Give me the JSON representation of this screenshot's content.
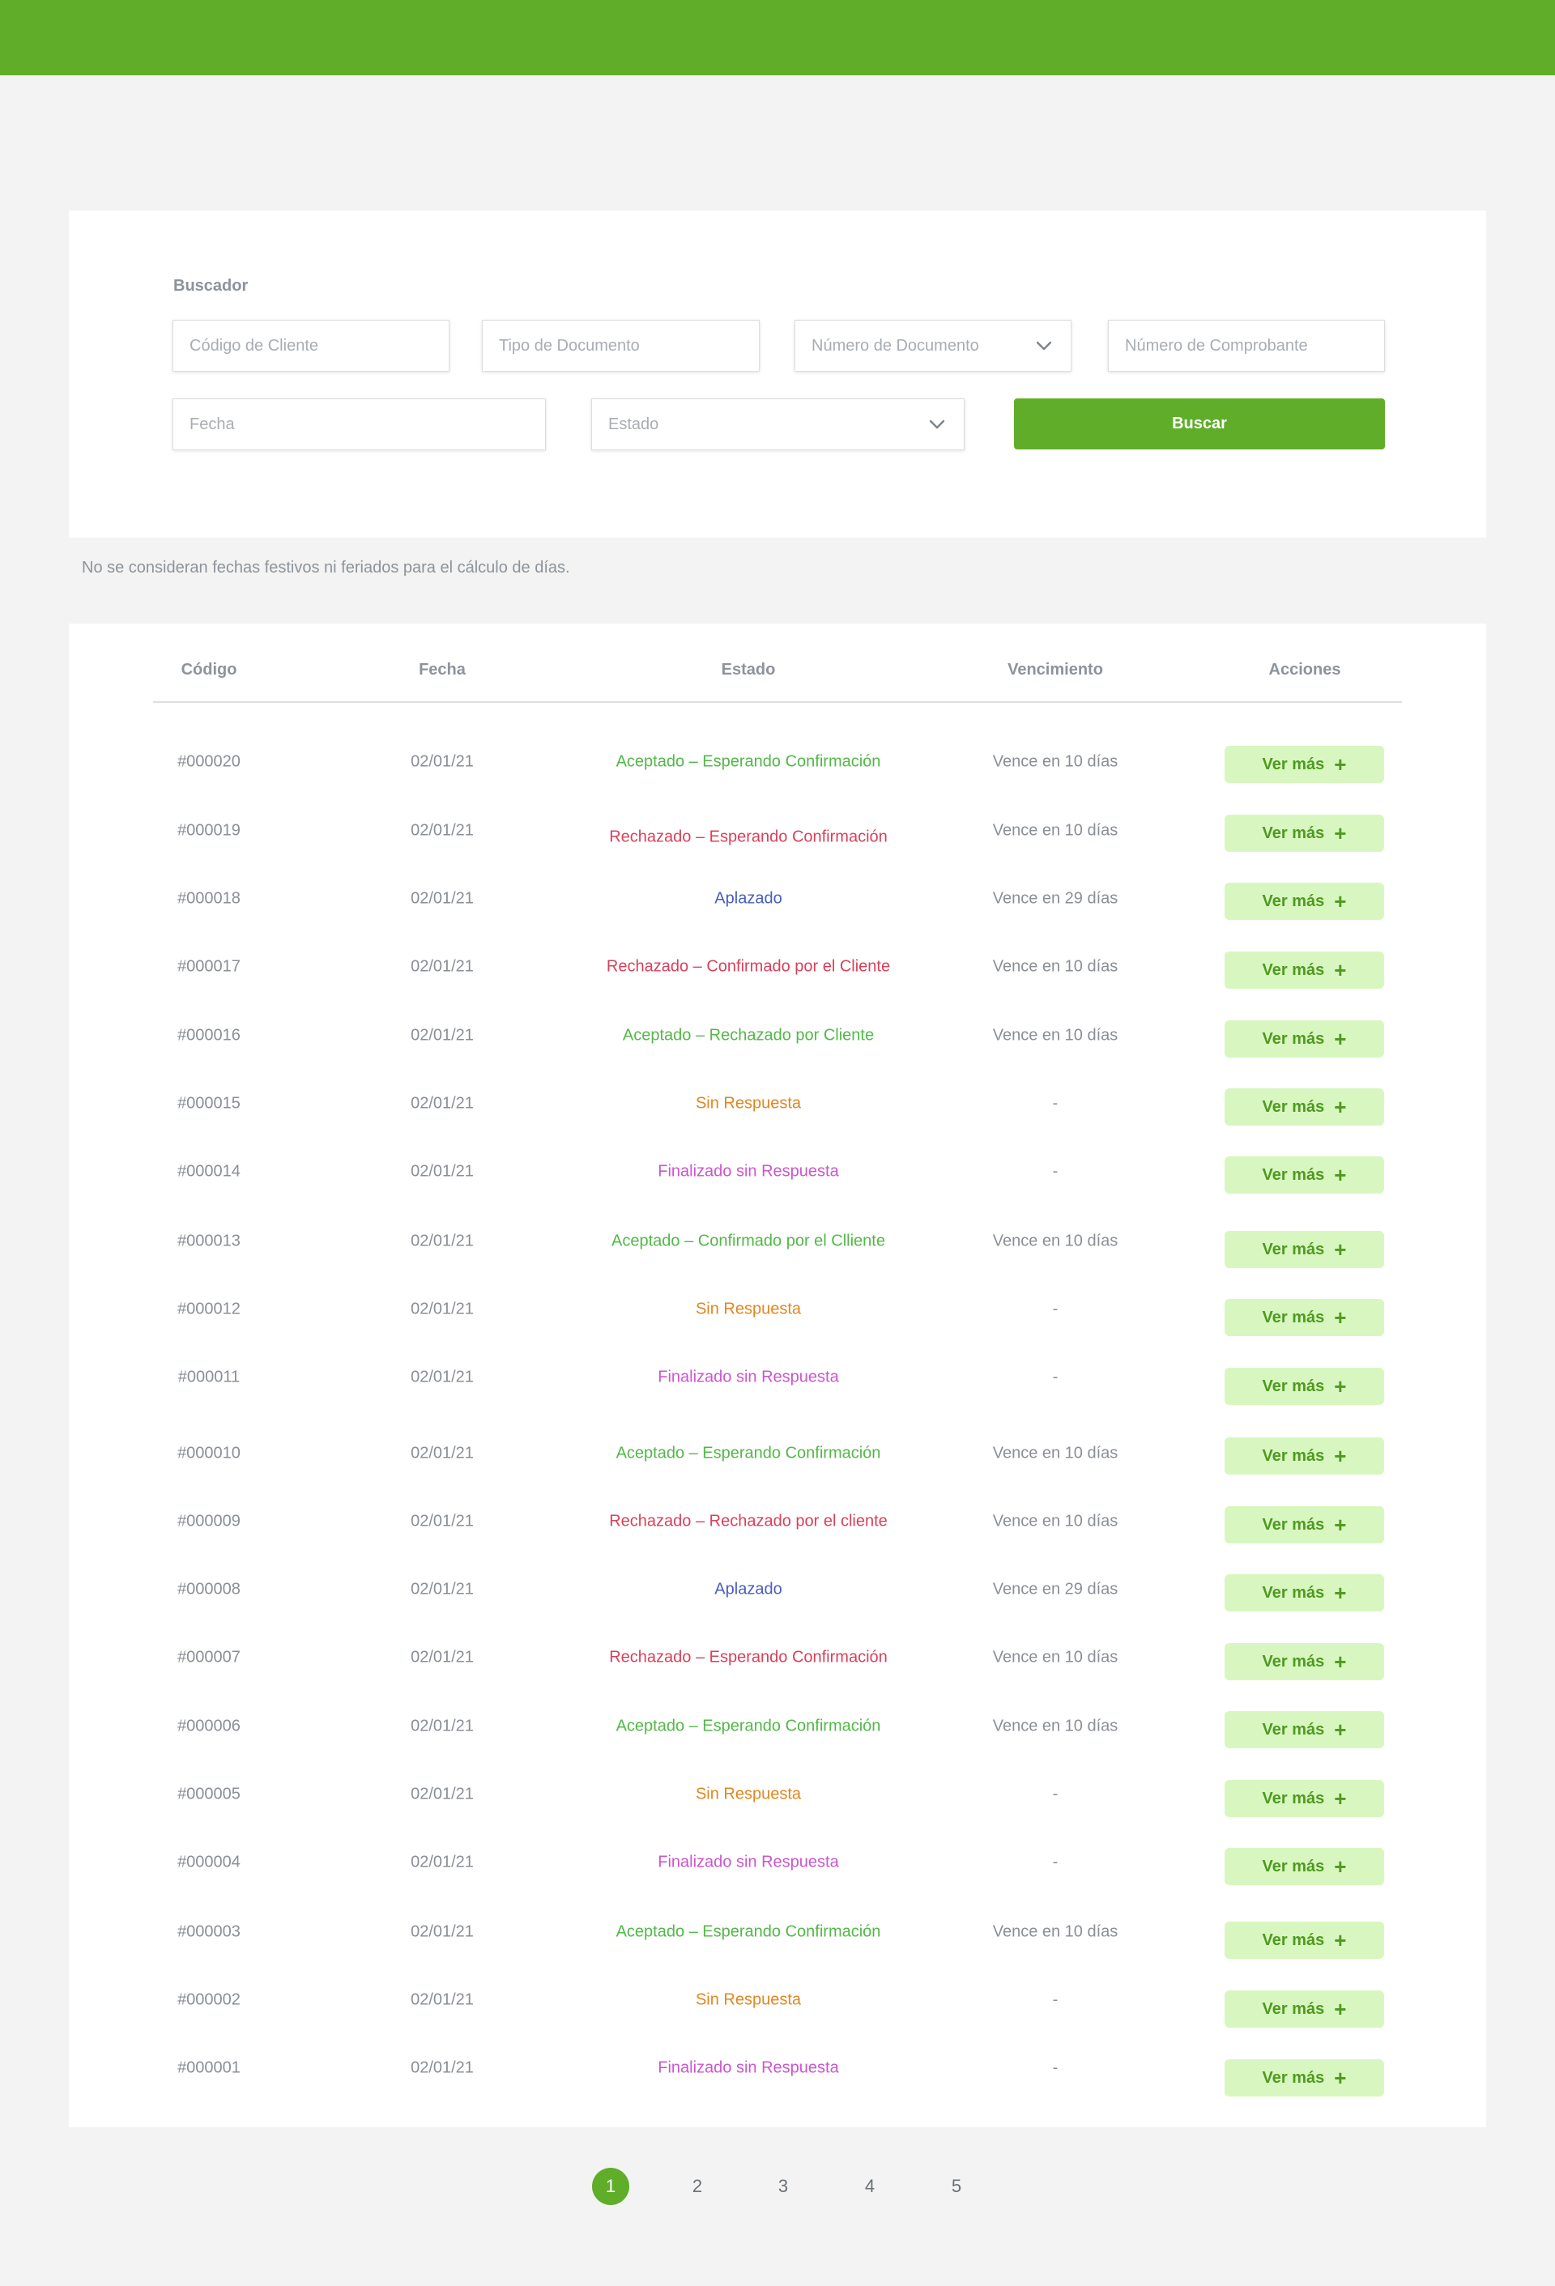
{
  "colors": {
    "brand": "#60ad29",
    "accepted": "#52b847",
    "rejected": "#d9405a",
    "deferred": "#4a5ec1",
    "no_response": "#e2861e",
    "finished": "#cc55cf",
    "button_light": "#d8f7c0"
  },
  "search": {
    "title": "Buscador",
    "client_code_placeholder": "Código de Cliente",
    "doc_type_placeholder": "Tipo de Documento",
    "doc_number_placeholder": "Número de Documento",
    "voucher_number_placeholder": "Número de Comprobante",
    "date_placeholder": "Fecha",
    "status_placeholder": "Estado",
    "search_button": "Buscar"
  },
  "note": "No se consideran fechas festivos ni feriados para el cálculo de días.",
  "table": {
    "headers": [
      "Código",
      "Fecha",
      "Estado",
      "Vencimiento",
      "Acciones"
    ],
    "action_label": "Ver más",
    "action_icon": "plus-icon",
    "rows": [
      {
        "code": "#000020",
        "date": "02/01/21",
        "status": "Aceptado – Esperando Confirmación",
        "status_kind": "accepted",
        "due": "Vence en 10 días"
      },
      {
        "code": "#000019",
        "date": "02/01/21",
        "status": "Rechazado – Esperando Confirmación",
        "status_kind": "rejected",
        "due": "Vence en 10 días"
      },
      {
        "code": "#000018",
        "date": "02/01/21",
        "status": "Aplazado",
        "status_kind": "deferred",
        "due": "Vence en 29 días"
      },
      {
        "code": "#000017",
        "date": "02/01/21",
        "status": "Rechazado – Confirmado por el Cliente",
        "status_kind": "rejected",
        "due": "Vence en 10 días"
      },
      {
        "code": "#000016",
        "date": "02/01/21",
        "status": "Aceptado – Rechazado por Cliente",
        "status_kind": "accepted",
        "due": "Vence en 10 días"
      },
      {
        "code": "#000015",
        "date": "02/01/21",
        "status": "Sin Respuesta",
        "status_kind": "no_response",
        "due": "-"
      },
      {
        "code": "#000014",
        "date": "02/01/21",
        "status": "Finalizado sin Respuesta",
        "status_kind": "finished",
        "due": "-"
      },
      {
        "code": "#000013",
        "date": "02/01/21",
        "status": "Aceptado – Confirmado por el Clliente",
        "status_kind": "accepted",
        "due": "Vence en 10 días"
      },
      {
        "code": "#000012",
        "date": "02/01/21",
        "status": "Sin Respuesta",
        "status_kind": "no_response",
        "due": "-"
      },
      {
        "code": "#000011",
        "date": "02/01/21",
        "status": "Finalizado sin Respuesta",
        "status_kind": "finished",
        "due": "-"
      },
      {
        "code": "#000010",
        "date": "02/01/21",
        "status": "Aceptado – Esperando Confirmación",
        "status_kind": "accepted",
        "due": "Vence en 10 días"
      },
      {
        "code": "#000009",
        "date": "02/01/21",
        "status": "Rechazado – Rechazado por el cliente",
        "status_kind": "rejected",
        "due": "Vence en 10 días"
      },
      {
        "code": "#000008",
        "date": "02/01/21",
        "status": "Aplazado",
        "status_kind": "deferred",
        "due": "Vence en 29 días"
      },
      {
        "code": "#000007",
        "date": "02/01/21",
        "status": "Rechazado – Esperando Confirmación",
        "status_kind": "rejected",
        "due": "Vence en 10 días"
      },
      {
        "code": "#000006",
        "date": "02/01/21",
        "status": "Aceptado – Esperando Confirmación",
        "status_kind": "accepted",
        "due": "Vence en 10 días"
      },
      {
        "code": "#000005",
        "date": "02/01/21",
        "status": "Sin Respuesta",
        "status_kind": "no_response",
        "due": "-"
      },
      {
        "code": "#000004",
        "date": "02/01/21",
        "status": "Finalizado sin Respuesta",
        "status_kind": "finished",
        "due": "-"
      },
      {
        "code": "#000003",
        "date": "02/01/21",
        "status": "Aceptado – Esperando Confirmación",
        "status_kind": "accepted",
        "due": "Vence en 10 días"
      },
      {
        "code": "#000002",
        "date": "02/01/21",
        "status": "Sin Respuesta",
        "status_kind": "no_response",
        "due": "-"
      },
      {
        "code": "#000001",
        "date": "02/01/21",
        "status": "Finalizado sin Respuesta",
        "status_kind": "finished",
        "due": "-"
      }
    ]
  },
  "pagination": {
    "pages": [
      "1",
      "2",
      "3",
      "4",
      "5"
    ],
    "current": "1"
  }
}
